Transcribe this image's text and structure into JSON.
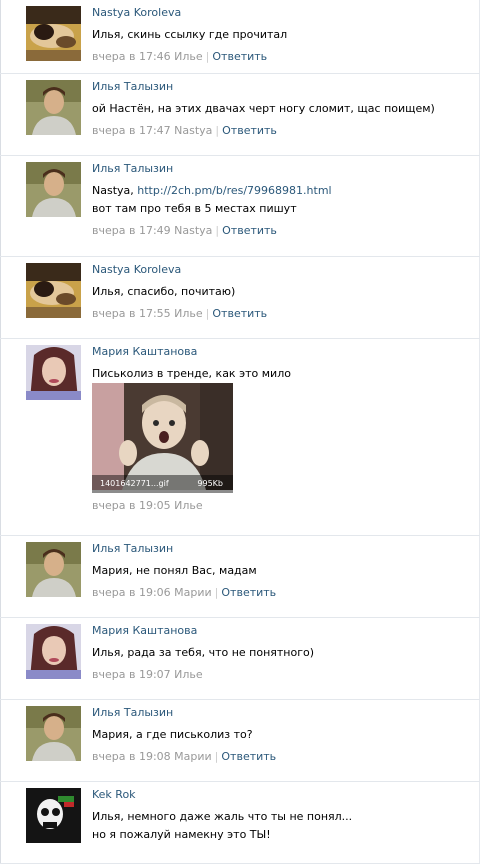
{
  "colors": {
    "link": "#2b587a",
    "meta": "#999999",
    "divider": "#e3e7ec"
  },
  "comments": [
    {
      "author": "Nastya Koroleva",
      "avatar": "avatar-nastya",
      "lines": [
        "Илья, скинь ссылку где прочитал"
      ],
      "time": "вчера в 17:46",
      "to": "Илье",
      "reply": "Ответить"
    },
    {
      "author": "Илья Талызин",
      "avatar": "avatar-ilya",
      "lines": [
        "ой Настён, на этих двачах черт ногу сломит, щас поищем)"
      ],
      "time": "вчера в 17:47",
      "to": "Nastya",
      "reply": "Ответить"
    },
    {
      "author": "Илья Талызин",
      "avatar": "avatar-ilya",
      "line1_prefix": "Nastya, ",
      "link": "http://2ch.pm/b/res/79968981.html",
      "lines": [
        "вот там про тебя в 5 местах пишут"
      ],
      "time": "вчера в 17:49",
      "to": "Nastya",
      "reply": "Ответить"
    },
    {
      "author": "Nastya Koroleva",
      "avatar": "avatar-nastya",
      "lines": [
        "Илья, спасибо, почитаю)"
      ],
      "time": "вчера в 17:55",
      "to": "Илье",
      "reply": "Ответить"
    },
    {
      "author": "Мария Каштанова",
      "avatar": "avatar-maria",
      "lines": [
        "Письколиз в тренде, как это мило"
      ],
      "attachment": {
        "filename": "1401642771...gif",
        "size": "995Kb"
      },
      "time": "вчера в 19:05",
      "to": "Илье",
      "reply": ""
    },
    {
      "author": "Илья Талызин",
      "avatar": "avatar-ilya",
      "lines": [
        "Мария, не понял Вас, мадам"
      ],
      "time": "вчера в 19:06",
      "to": "Марии",
      "reply": "Ответить"
    },
    {
      "author": "Мария Каштанова",
      "avatar": "avatar-maria",
      "lines": [
        "Илья, рада за тебя, что не понятного)"
      ],
      "time": "вчера в 19:07",
      "to": "Илье",
      "reply": ""
    },
    {
      "author": "Илья Талызин",
      "avatar": "avatar-ilya",
      "lines": [
        "Мария, а где письколиз то?"
      ],
      "time": "вчера в 19:08",
      "to": "Марии",
      "reply": "Ответить"
    },
    {
      "author": "Kek Rok",
      "avatar": "avatar-kek",
      "lines": [
        "Илья, немного даже жаль что ты не понял...",
        "но я пожалуй намекну это ТЫ!"
      ],
      "time": "",
      "to": "",
      "reply": ""
    }
  ]
}
